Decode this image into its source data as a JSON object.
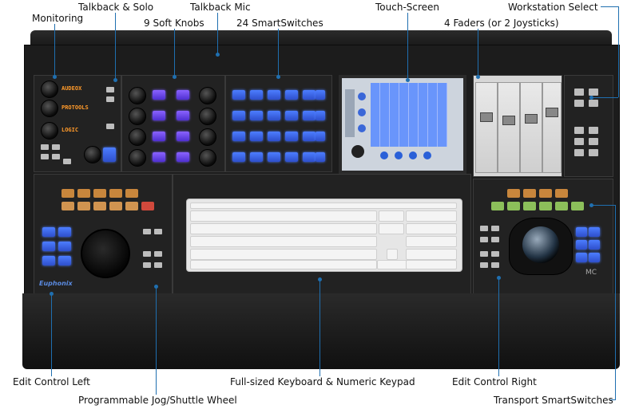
{
  "labels": {
    "monitoring": "Monitoring",
    "talkback_solo": "Talkback & Solo",
    "talkback_mic": "Talkback Mic",
    "soft_knobs": "9 Soft Knobs",
    "smartswitches": "24 SmartSwitches",
    "touch_screen": "Touch-Screen",
    "faders": "4 Faders (or 2 Joysticks)",
    "workstation_select": "Workstation Select",
    "edit_control_left": "Edit Control Left",
    "keyboard": "Full-sized Keyboard & Numeric Keypad",
    "edit_control_right": "Edit Control Right",
    "jog_wheel": "Programmable Jog/Shuttle Wheel",
    "transport": "Transport SmartSwitches"
  },
  "device": {
    "brand": "Euphonix",
    "model": "MC",
    "display_lines": [
      "AUDEOX",
      "PROTOOLS",
      "LOGIC"
    ]
  },
  "colors": {
    "leader_line": "#1f6fb0",
    "smartswitch_glow": "#7a5cff",
    "touchscreen": "#5f8fff"
  }
}
